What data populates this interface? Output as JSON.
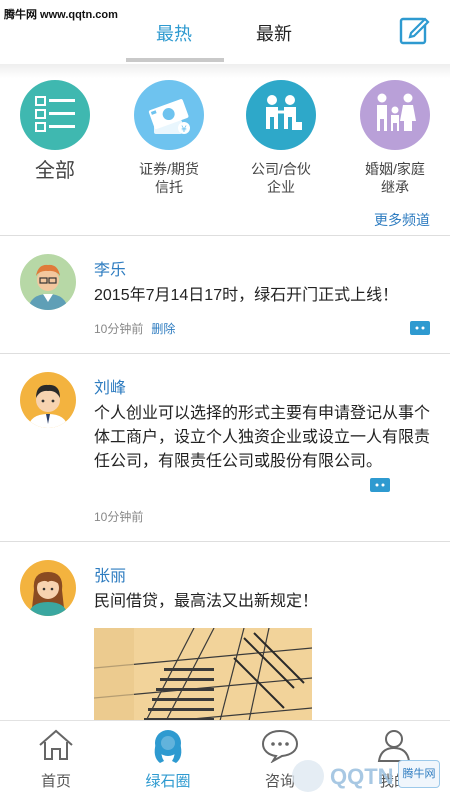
{
  "watermark_top": "腾牛网 www.qqtn.com",
  "header": {
    "tabs": [
      {
        "label": "最热",
        "active": true
      },
      {
        "label": "最新",
        "active": false
      }
    ],
    "edit_icon": "edit-icon"
  },
  "categories": [
    {
      "label": "全部",
      "icon": "list-icon",
      "color": "#3fb8b0"
    },
    {
      "label": "证券/期货\n信托",
      "icon": "money-icon",
      "color": "#6ec3ef"
    },
    {
      "label": "公司/合伙\n企业",
      "icon": "handshake-icon",
      "color": "#2ea8c9"
    },
    {
      "label": "婚姻/家庭\n继承",
      "icon": "family-icon",
      "color": "#b9a0d8"
    }
  ],
  "more_channels": "更多频道",
  "posts": [
    {
      "author": "李乐",
      "text": "2015年7月14日17时，绿石开门正式上线！",
      "time": "10分钟前",
      "delete": "删除"
    },
    {
      "author": "刘峰",
      "text": "个人创业可以选择的形式主要有申请登记从事个体工商户，设立个人独资企业或设立一人有限责任公司，有限责任公司或股份有限公司。",
      "time": "10分钟前"
    },
    {
      "author": "张丽",
      "text": "民间借贷，最高法又出新规定！"
    }
  ],
  "nav": [
    {
      "label": "首页",
      "icon": "home-icon",
      "active": false
    },
    {
      "label": "绿石圈",
      "icon": "circle-icon",
      "active": true
    },
    {
      "label": "咨询",
      "icon": "chat-icon",
      "active": false
    },
    {
      "label": "我的",
      "icon": "user-icon",
      "active": false
    }
  ],
  "watermark_badge": "腾牛网",
  "colors": {
    "accent": "#2e9ad0",
    "link": "#2e7cc0"
  }
}
